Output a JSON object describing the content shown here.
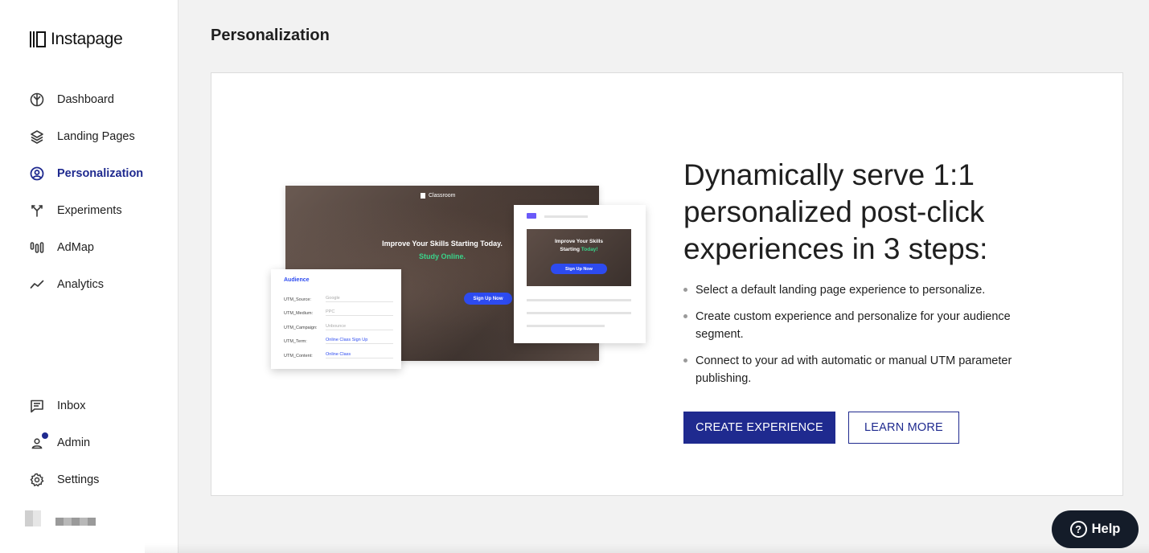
{
  "brand": {
    "name": "Instapage"
  },
  "sidebar": {
    "items": [
      {
        "label": "Dashboard",
        "icon": "dashboard-icon"
      },
      {
        "label": "Landing Pages",
        "icon": "layers-icon"
      },
      {
        "label": "Personalization",
        "icon": "user-circle-icon",
        "active": true
      },
      {
        "label": "Experiments",
        "icon": "split-icon"
      },
      {
        "label": "AdMap",
        "icon": "admap-icon"
      },
      {
        "label": "Analytics",
        "icon": "trend-icon"
      }
    ],
    "bottom_items": [
      {
        "label": "Inbox",
        "icon": "chat-icon"
      },
      {
        "label": "Admin",
        "icon": "person-icon",
        "notification": true
      },
      {
        "label": "Settings",
        "icon": "gear-icon"
      }
    ]
  },
  "main": {
    "title": "Personalization",
    "illustration": {
      "hero_brand": "Classroom",
      "hero_headline": "Improve Your Skills Starting Today.",
      "hero_subline": "Study Online.",
      "hero_button": "Sign Up Now",
      "form_title": "Audience",
      "form_rows": [
        {
          "key": "UTM_Source:",
          "value": "Google"
        },
        {
          "key": "UTM_Medium:",
          "value": "PPC"
        },
        {
          "key": "UTM_Campaign:",
          "value": "Unbounce"
        },
        {
          "key": "UTM_Term:",
          "value": "Online Class Sign Up"
        },
        {
          "key": "UTM_Content:",
          "value": "Online Class"
        }
      ],
      "mini_headline": "Improve Your Skills",
      "mini_headline_2": "Starting",
      "mini_headline_accent": "Today!",
      "mini_button": "Sign Up Now"
    },
    "headline": "Dynamically serve 1:1 personalized post-click experiences in 3 steps:",
    "steps": [
      "Select a default landing page experience to personalize.",
      "Create custom experience and personalize for your audience segment.",
      "Connect to your ad with automatic or manual UTM parameter publishing."
    ],
    "primary_button": "CREATE EXPERIENCE",
    "secondary_button": "LEARN MORE"
  },
  "help": {
    "label": "Help",
    "glyph": "?"
  },
  "colors": {
    "accent": "#1f2a8f",
    "illustration_blue": "#2d4bf0",
    "illustration_green": "#3ad48a",
    "help_bg": "#141c29"
  }
}
